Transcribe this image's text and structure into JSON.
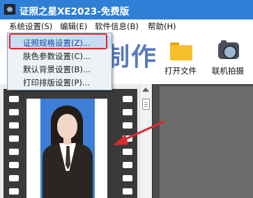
{
  "window": {
    "title": "证照之星XE2023-免费版",
    "icon": "app-logo-icon"
  },
  "menubar": {
    "items": [
      {
        "label": "系统设置(S)"
      },
      {
        "label": "编辑(E)"
      },
      {
        "label": "软件信息(B)"
      },
      {
        "label": "帮助(H)"
      }
    ]
  },
  "dropdown": {
    "items": [
      {
        "label": "证照规格设置(Z)..."
      },
      {
        "label": "肤色参数设置(C)..."
      },
      {
        "label": "默认背景设置(B)..."
      },
      {
        "label": "打印排版设置(P)..."
      }
    ],
    "highlight_color": "#e0272b"
  },
  "toolbar": {
    "banner_text": "制作",
    "open_file": {
      "label": "打开文件",
      "icon": "folder-icon"
    },
    "camera": {
      "label": "联机拍摄",
      "icon": "camera-icon"
    }
  },
  "colors": {
    "titlebar": "#2f7fd6",
    "photo_background": "#3d7fd6",
    "annotation_red": "#e0272b"
  }
}
